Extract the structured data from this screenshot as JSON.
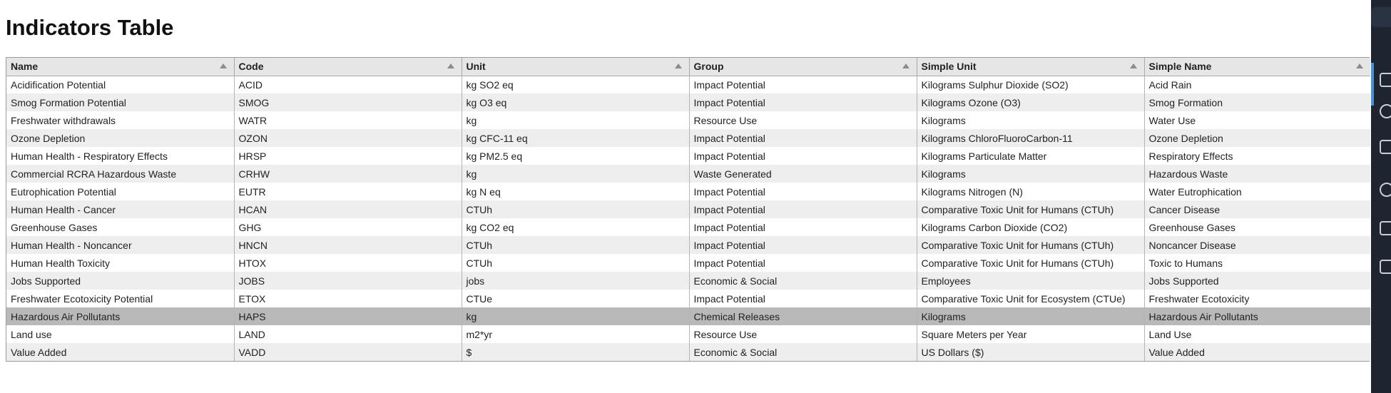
{
  "page": {
    "title": "Indicators Table"
  },
  "table": {
    "columns": [
      "Name",
      "Code",
      "Unit",
      "Group",
      "Simple Unit",
      "Simple Name"
    ],
    "rows": [
      [
        "Acidification Potential",
        "ACID",
        "kg SO2 eq",
        "Impact Potential",
        "Kilograms Sulphur Dioxide (SO2)",
        "Acid Rain"
      ],
      [
        "Smog Formation Potential",
        "SMOG",
        "kg O3 eq",
        "Impact Potential",
        "Kilograms Ozone (O3)",
        "Smog Formation"
      ],
      [
        "Freshwater withdrawals",
        "WATR",
        "kg",
        "Resource Use",
        "Kilograms",
        "Water Use"
      ],
      [
        "Ozone Depletion",
        "OZON",
        "kg CFC-11 eq",
        "Impact Potential",
        "Kilograms ChloroFluoroCarbon-11",
        "Ozone Depletion"
      ],
      [
        "Human Health - Respiratory Effects",
        "HRSP",
        "kg PM2.5 eq",
        "Impact Potential",
        "Kilograms Particulate Matter",
        "Respiratory Effects"
      ],
      [
        "Commercial RCRA Hazardous Waste",
        "CRHW",
        "kg",
        "Waste Generated",
        "Kilograms",
        "Hazardous Waste"
      ],
      [
        "Eutrophication Potential",
        "EUTR",
        "kg N eq",
        "Impact Potential",
        "Kilograms Nitrogen (N)",
        "Water Eutrophication"
      ],
      [
        "Human Health - Cancer",
        "HCAN",
        "CTUh",
        "Impact Potential",
        "Comparative Toxic Unit for Humans (CTUh)",
        "Cancer Disease"
      ],
      [
        "Greenhouse Gases",
        "GHG",
        "kg CO2 eq",
        "Impact Potential",
        "Kilograms Carbon Dioxide (CO2)",
        "Greenhouse Gases"
      ],
      [
        "Human Health - Noncancer",
        "HNCN",
        "CTUh",
        "Impact Potential",
        "Comparative Toxic Unit for Humans (CTUh)",
        "Noncancer Disease"
      ],
      [
        "Human Health Toxicity",
        "HTOX",
        "CTUh",
        "Impact Potential",
        "Comparative Toxic Unit for Humans (CTUh)",
        "Toxic to Humans"
      ],
      [
        "Jobs Supported",
        "JOBS",
        "jobs",
        "Economic & Social",
        "Employees",
        "Jobs Supported"
      ],
      [
        "Freshwater Ecotoxicity Potential",
        "ETOX",
        "CTUe",
        "Impact Potential",
        "Comparative Toxic Unit for Ecosystem (CTUe)",
        "Freshwater Ecotoxicity"
      ],
      [
        "Hazardous Air Pollutants",
        "HAPS",
        "kg",
        "Chemical Releases",
        "Kilograms",
        "Hazardous Air Pollutants"
      ],
      [
        "Land use",
        "LAND",
        "m2*yr",
        "Resource Use",
        "Square Meters per Year",
        "Land Use"
      ],
      [
        "Value Added",
        "VADD",
        "$",
        "Economic & Social",
        "US Dollars ($)",
        "Value Added"
      ]
    ],
    "selected_row": 13
  },
  "icons": {
    "sort": "sort-asc-icon"
  },
  "colors": {
    "header_bg": "#e6e6e6",
    "row_alt": "#eeeeee",
    "row_selected": "#b9b9b9"
  }
}
